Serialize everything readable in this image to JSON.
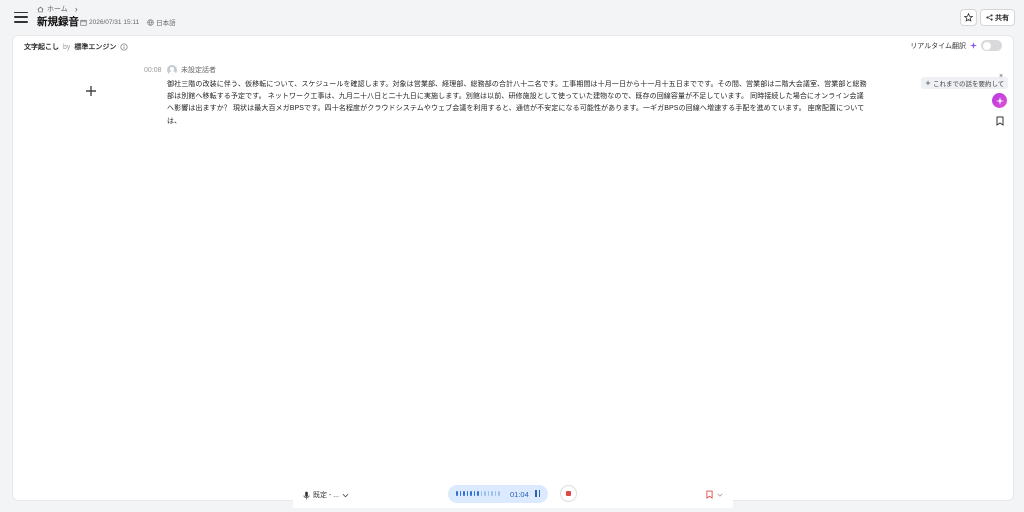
{
  "header": {
    "breadcrumb_home": "ホーム",
    "title": "新規録音",
    "date": "2026/07/31 15:11",
    "language": "日本語",
    "share_label": "共有"
  },
  "panel": {
    "transcription_label": "文字起こし",
    "by_label": "by",
    "engine": "標準エンジン",
    "realtime_label": "リアルタイム翻訳",
    "segment": {
      "time": "00:08",
      "speaker": "未設定話者",
      "text": "御社三階の改装に伴う、仮移転について、スケジュールを確認します。対象は営業部、経理部、総務部の合計八十二名です。工事期間は十月一日から十一月十五日までです。その間、営業部は二階大会議室、営業部と総務部は別館へ移転する予定です。 ネットワーク工事は、九月二十八日と二十九日に実施します。別館は以前、研修施設として使っていた建物なので、既存の回線容量が不足しています。 同時接続した場合にオンライン会議へ影響は出ますか？ 現状は最大百メガBPSです。四十名程度がクラウドシステムやウェブ会議を利用すると、通信が不安定になる可能性があります。一ギガBPSの回線へ増速する手配を進めています。 座席配置については、"
    },
    "tooltip": "これまでの話を要約して",
    "tooltip_close": "×"
  },
  "bottombar": {
    "mic_label": "既定 - ...",
    "rec_time": "01:04"
  },
  "colors": {
    "accent": "#2f6fd6",
    "ai_gradient_start": "#b63ae6",
    "stop": "#e04848"
  }
}
